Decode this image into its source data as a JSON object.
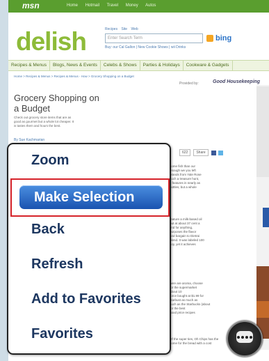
{
  "msn": {
    "logo": "msn",
    "nav": [
      "Home",
      "Hotmail",
      "Travel",
      "Money",
      "Autos"
    ]
  },
  "site": {
    "logo": "delish"
  },
  "search": {
    "tabs": [
      "Recipes",
      "Site",
      "Web"
    ],
    "placeholder": "Enter Search Term",
    "engine": "bing",
    "links": "Buy: our Cal Gallon | New Cookie Shows | wii Drinks"
  },
  "nav": [
    "Recipes & Menus",
    "Blogs, News & Events",
    "Celebs & Shows",
    "Parties & Holidays",
    "Cookware & Gadgets"
  ],
  "breadcrumb": "Home > Recipes & Menus > Recipes & Menus - How > Grocery Shopping on a Budget",
  "provided_by": "Provided by:",
  "sponsor": "Good Housekeeping",
  "article": {
    "title": "Grocery Shopping on a Budget",
    "desc": "Check out grocery store items that are as good as gourmet but a whole lot cheaper. It is tastes them and hours the best.",
    "byline": "By Sue Kachmarian"
  },
  "share": {
    "count": "622",
    "label": "Share"
  },
  "body": [
    "some fish than our\nenough we you left\nbrands from Yale Rose\nsuch a treasure hunt,\nit features in nearly as\nbottles, but a whole",
    "feature a milk-based oil\nbut at about 37 cent a\nfind for anything,\npurposes the flavor\nand bargain to Dietrai\nblend. It was labeled 100\nsoy, yet it achieves",
    "here are aroma, choose\nfor the supermarket\nabout 10\nforce bought at $1.99 for\nstarbust as much as\nsuch as the Starbucks (about\nfor the best\ngood price recipes",
    "Of the super ties, Oh Chips has the\nsome for the bread with a cost"
  ],
  "menu": {
    "zoom": "Zoom",
    "make_selection": "Make Selection",
    "back": "Back",
    "refresh": "Refresh",
    "add_favorites": "Add to Favorites",
    "favorites": "Favorites"
  },
  "colors": {
    "accent_green": "#8dbb39",
    "selection_blue": "#1a53b0",
    "highlight_red": "#d6232a"
  }
}
